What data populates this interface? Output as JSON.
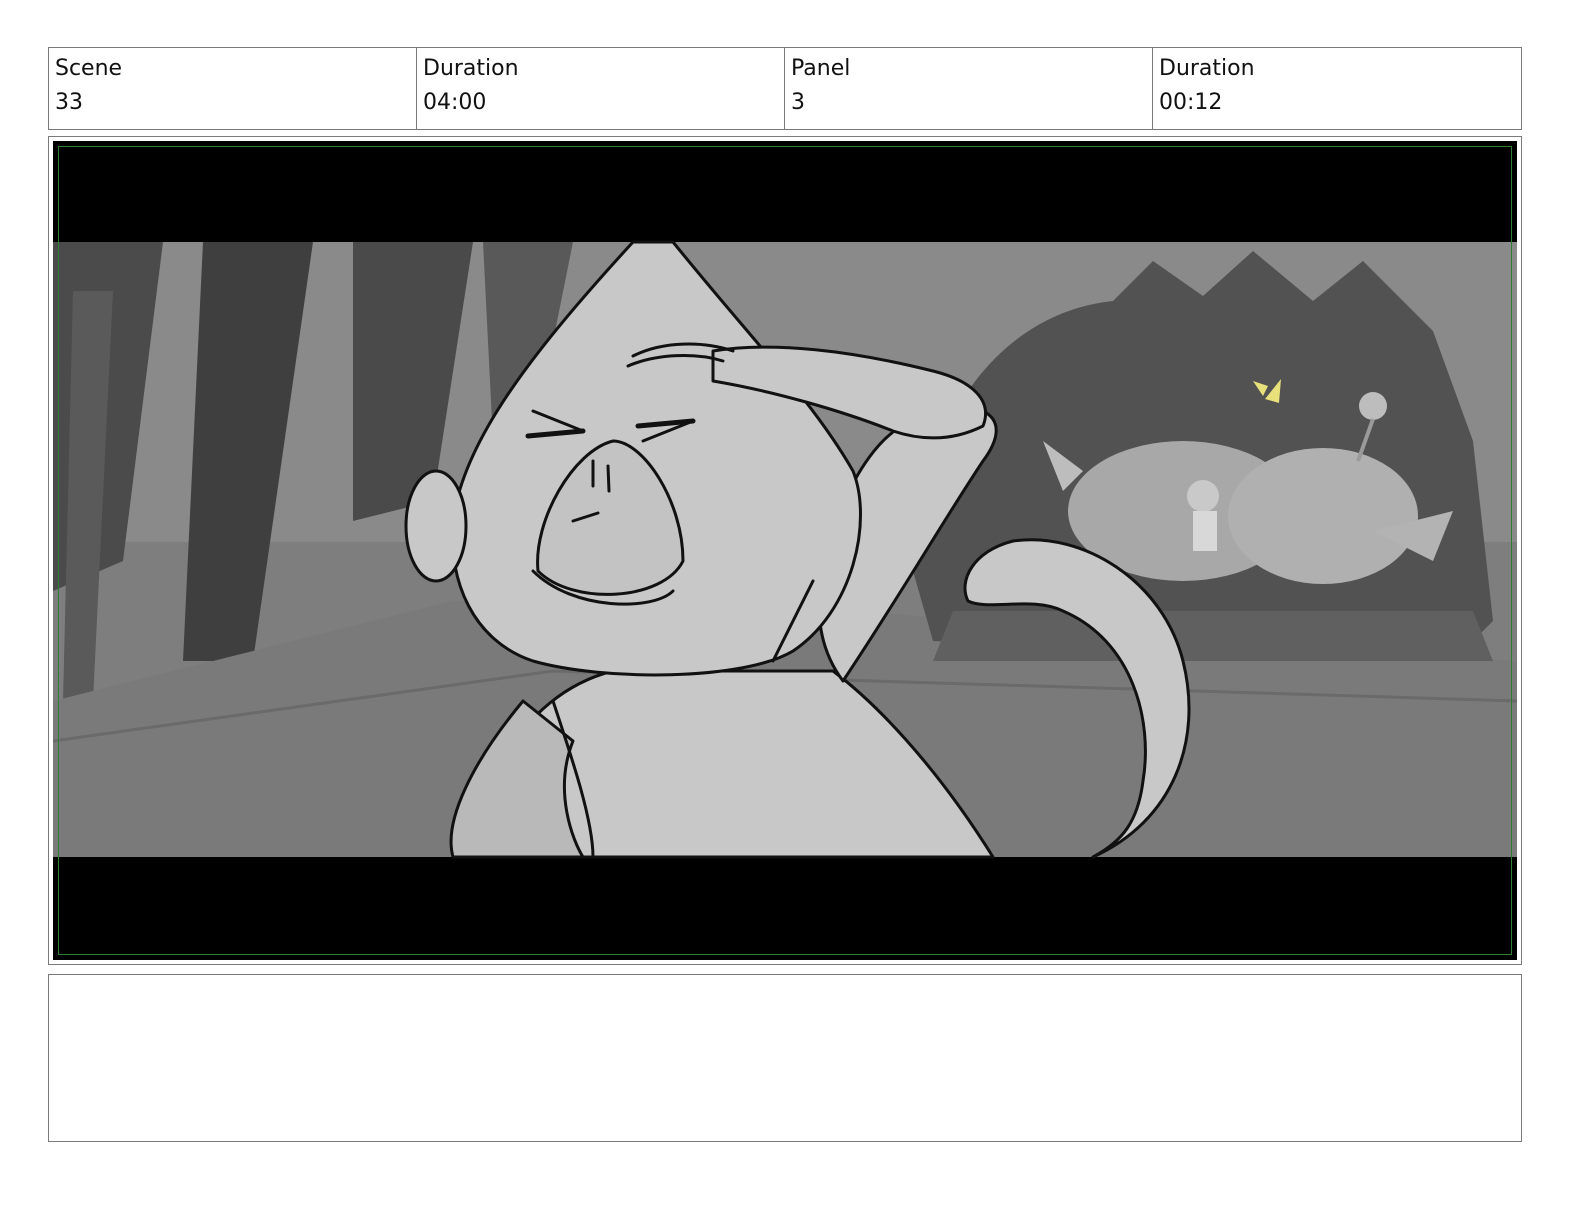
{
  "header": {
    "scene_label": "Scene",
    "scene_value": "33",
    "scene_duration_label": "Duration",
    "scene_duration_value": "04:00",
    "panel_label": "Panel",
    "panel_value": "3",
    "panel_duration_label": "Duration",
    "panel_duration_value": "00:12"
  },
  "notes": {
    "text": ""
  },
  "colors": {
    "safe_frame": "#2e7d32",
    "letterbox": "#000000",
    "bg_mid": "#7d7d7d",
    "bg_dark": "#555555",
    "character_fill": "#c8c8c8",
    "butterfly": "#e8e07a"
  }
}
